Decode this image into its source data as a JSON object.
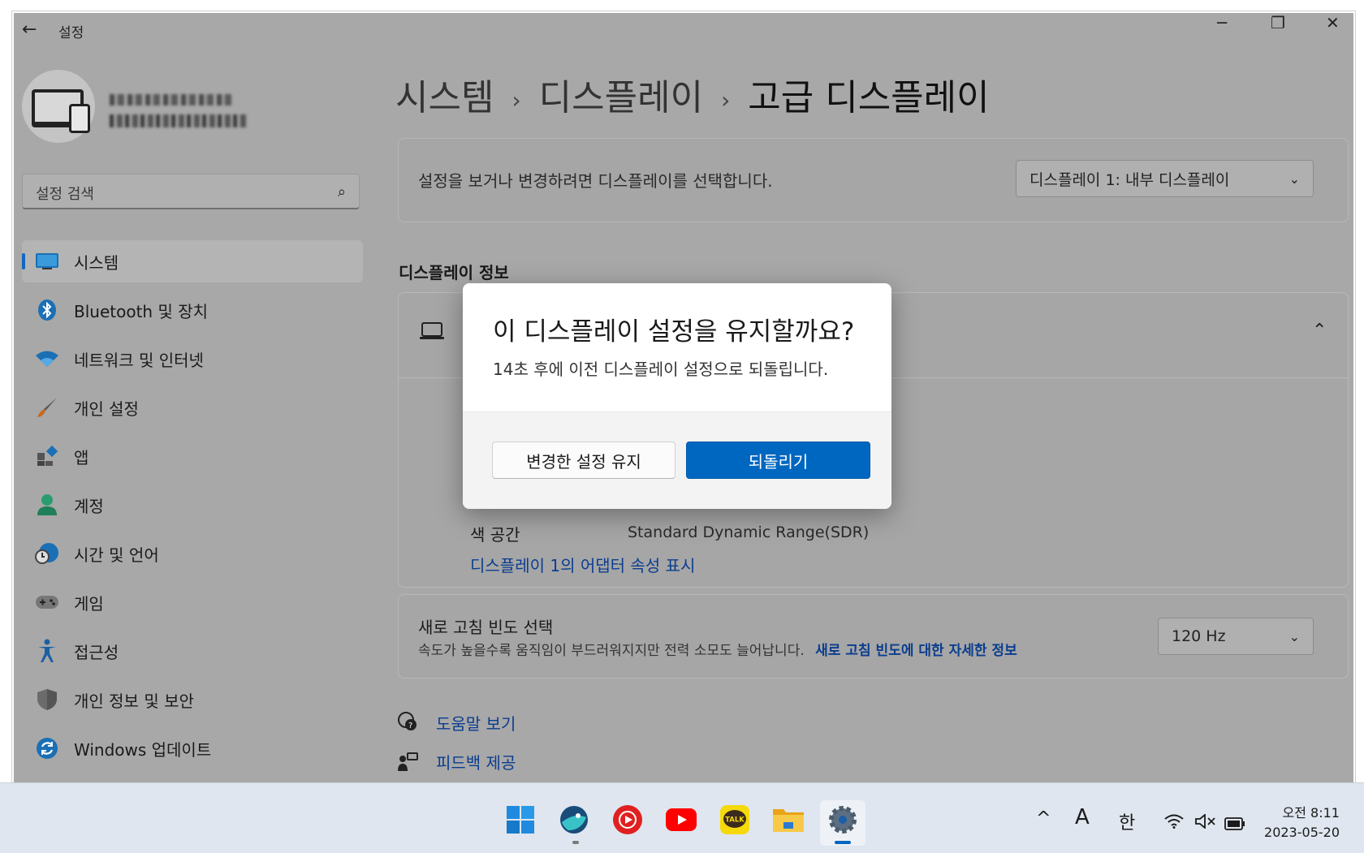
{
  "window": {
    "title": "설정",
    "back_icon": "arrow-left-icon",
    "minimize": "─",
    "maximize": "❐",
    "close": "✕"
  },
  "search": {
    "placeholder": "설정 검색"
  },
  "sidebar": {
    "items": [
      {
        "label": "시스템",
        "icon": "monitor-icon",
        "selected": true
      },
      {
        "label": "Bluetooth 및 장치",
        "icon": "bluetooth-icon"
      },
      {
        "label": "네트워크 및 인터넷",
        "icon": "wifi-icon"
      },
      {
        "label": "개인 설정",
        "icon": "brush-icon"
      },
      {
        "label": "앱",
        "icon": "apps-icon"
      },
      {
        "label": "계정",
        "icon": "person-icon"
      },
      {
        "label": "시간 및 언어",
        "icon": "clock-globe-icon"
      },
      {
        "label": "게임",
        "icon": "gamepad-icon"
      },
      {
        "label": "접근성",
        "icon": "accessibility-icon"
      },
      {
        "label": "개인 정보 및 보안",
        "icon": "shield-icon"
      },
      {
        "label": "Windows 업데이트",
        "icon": "update-icon"
      }
    ]
  },
  "breadcrumb": {
    "level1": "시스템",
    "level2": "디스플레이",
    "current": "고급 디스플레이",
    "sep": "›"
  },
  "display_select": {
    "text": "설정을 보거나 변경하려면 디스플레이를 선택합니다.",
    "value": "디스플레이 1: 내부 디스플레이"
  },
  "display_info": {
    "section_title": "디스플레이 정보",
    "color_space_label": "색 공간",
    "color_space_value": "Standard Dynamic Range(SDR)",
    "adapter_link": "디스플레이 1의 어댑터 속성 표시"
  },
  "refresh": {
    "title": "새로 고침 빈도 선택",
    "description": "속도가 높을수록 움직임이 부드러워지지만 전력 소모도 늘어납니다.",
    "link": "새로 고침 빈도에 대한 자세한 정보",
    "value": "120 Hz"
  },
  "help": {
    "help_link": "도움말 보기",
    "feedback_link": "피드백 제공"
  },
  "dialog": {
    "title": "이 디스플레이 설정을 유지할까요?",
    "message": "14초 후에 이전 디스플레이 설정으로 되돌립니다.",
    "keep_button": "변경한 설정 유지",
    "revert_button": "되돌리기"
  },
  "taskbar": {
    "apps": [
      "windows-start-icon",
      "whale-browser-icon",
      "youtube-music-icon",
      "youtube-icon",
      "kakaotalk-icon",
      "file-explorer-icon",
      "settings-gear-icon"
    ],
    "kakaotalk_label": "TALK",
    "tray_chevron": "^",
    "ime_mode": "A",
    "ime_lang": "한",
    "time": "오전 8:11",
    "date": "2023-05-20"
  },
  "colors": {
    "accent": "#0067c0",
    "link": "#0a3d8f",
    "dim_overlay": "#a8a8a8"
  }
}
